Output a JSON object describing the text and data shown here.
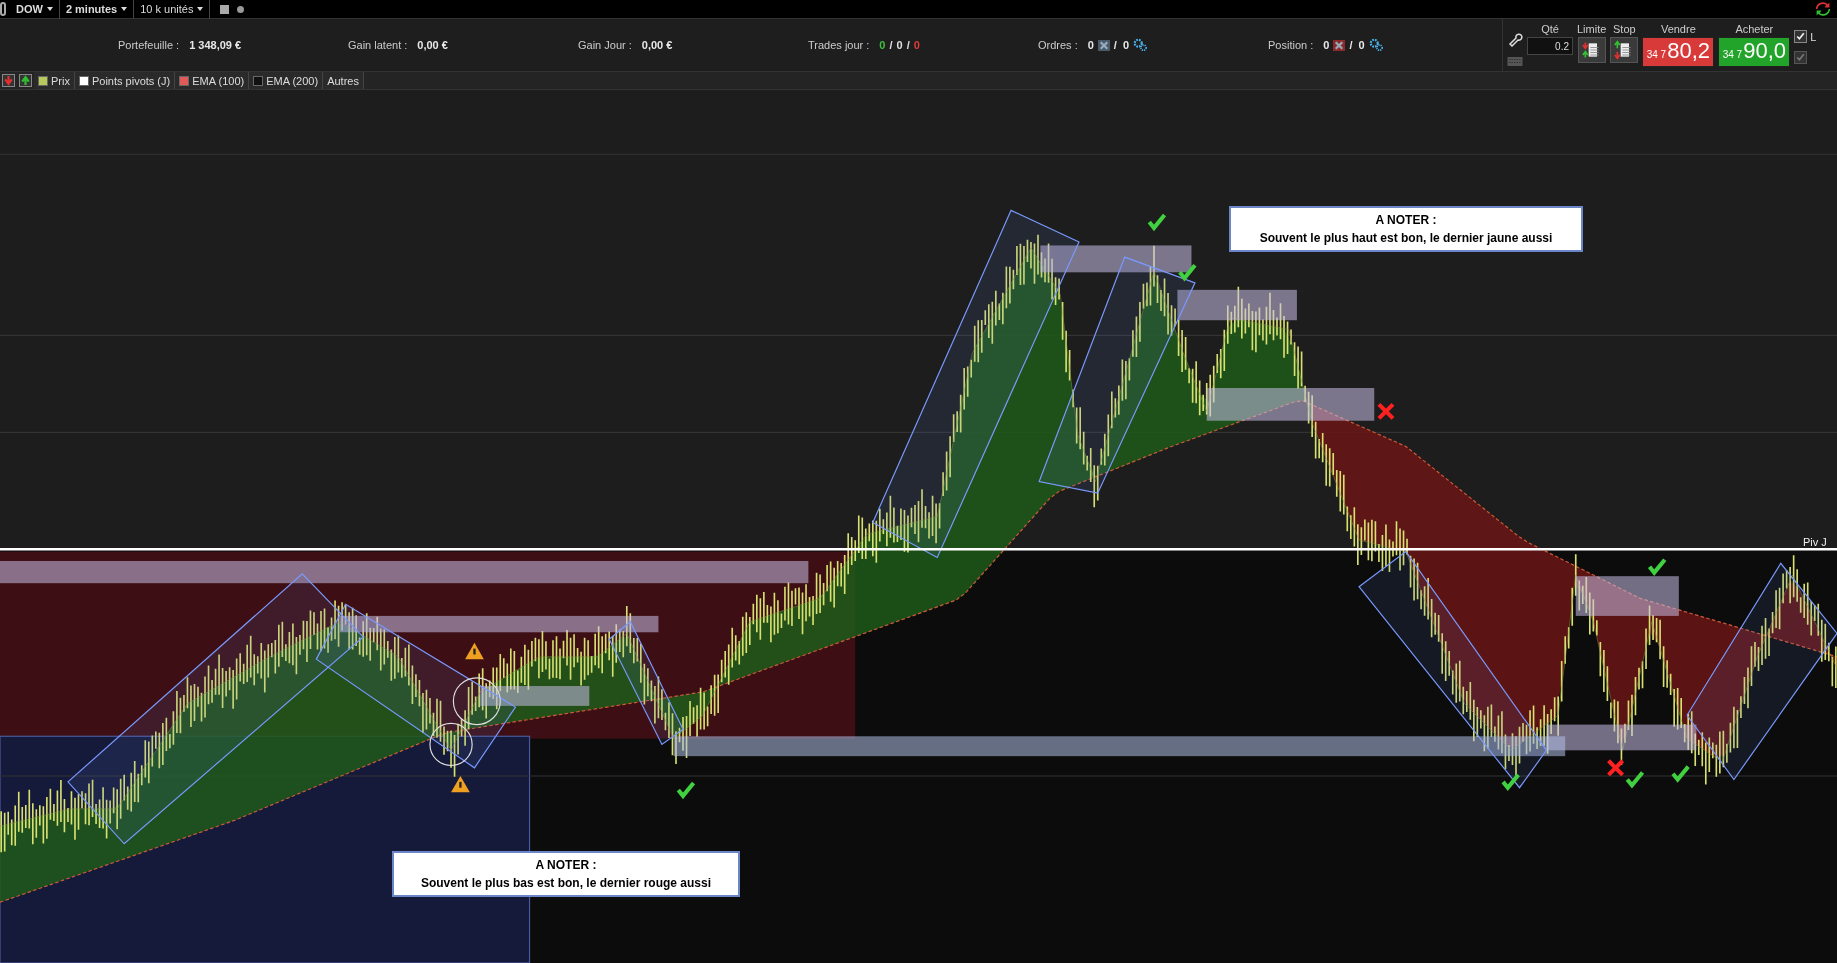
{
  "toolbar": {
    "instrument": "DOW",
    "timeframe": "2 minutes",
    "size": "10 k unités"
  },
  "info_bar": [
    {
      "kind": "value",
      "label": "Portefeuille :",
      "value": "1 348,09 €"
    },
    {
      "kind": "value",
      "label": "Gain latent :",
      "value": "0,00 €"
    },
    {
      "kind": "value",
      "label": "Gain Jour :",
      "value": "0,00 €"
    },
    {
      "kind": "counts",
      "label": "Trades jour :",
      "counts": [
        {
          "text": "0",
          "color": "#3fbf3f"
        },
        {
          "text": "/",
          "color": "#e0e0e0"
        },
        {
          "text": "0",
          "color": "#e0e0e0"
        },
        {
          "text": "/",
          "color": "#e0e0e0"
        },
        {
          "text": "0",
          "color": "#e03c3c"
        }
      ]
    },
    {
      "kind": "orders",
      "label": "Ordres :",
      "first": "0",
      "second": "/  0"
    },
    {
      "kind": "position",
      "label": "Position :",
      "first": "0",
      "second": "/  0"
    }
  ],
  "order_panel": {
    "qty_label": "Qté",
    "qty": "0.2",
    "limit_label": "Limite",
    "stop_label": "Stop",
    "sell": {
      "label": "Vendre",
      "prefix": "34 7",
      "price": "80,2"
    },
    "buy": {
      "label": "Acheter",
      "prefix": "34 7",
      "price": "90,0"
    },
    "checkboxes": [
      {
        "label": "L",
        "checked": true,
        "disabled": false
      },
      {
        "checked": true,
        "disabled": true
      }
    ]
  },
  "legend": [
    {
      "label": "Prix",
      "color": "#b8c85a"
    },
    {
      "label": "Points pivots (J)",
      "color": "#ffffff"
    },
    {
      "label": "EMA (100)",
      "color": "#e05a5a"
    },
    {
      "label": "EMA (200)",
      "color": "#111111"
    }
  ],
  "legend_more": "Autres",
  "chart": {
    "pivot_label": "Piv J",
    "notes": [
      {
        "title": "A NOTER :",
        "text": "Souvent le plus haut est bon, le dernier jaune aussi"
      },
      {
        "title": "A NOTER :",
        "text": "Souvent le plus bas est bon, le dernier rouge aussi"
      }
    ]
  }
}
